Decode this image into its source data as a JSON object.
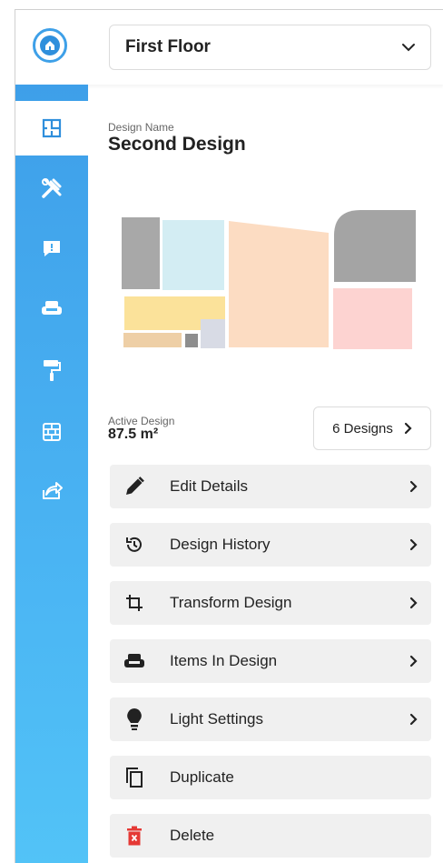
{
  "header": {
    "floor_selector": {
      "value": "First Floor"
    }
  },
  "sidebar": {
    "items": [
      {
        "icon": "floorplan-icon",
        "active": true
      },
      {
        "icon": "tools-icon",
        "active": false
      },
      {
        "icon": "comment-icon",
        "active": false
      },
      {
        "icon": "sofa-icon",
        "active": false
      },
      {
        "icon": "paint-roller-icon",
        "active": false
      },
      {
        "icon": "wall-bricks-icon",
        "active": false
      },
      {
        "icon": "share-icon",
        "active": false
      }
    ]
  },
  "design": {
    "name_label": "Design Name",
    "name": "Second Design",
    "active_label": "Active Design",
    "area": "87.5 m²",
    "designs_button": "6 Designs"
  },
  "menu": [
    {
      "label": "Edit Details",
      "icon": "pencil-icon"
    },
    {
      "label": "Design History",
      "icon": "history-icon"
    },
    {
      "label": "Transform Design",
      "icon": "crop-icon"
    },
    {
      "label": "Items In Design",
      "icon": "sofa-icon"
    },
    {
      "label": "Light Settings",
      "icon": "bulb-icon"
    },
    {
      "label": "Duplicate",
      "icon": "duplicate-icon"
    },
    {
      "label": "Delete",
      "icon": "trash-icon"
    }
  ],
  "colors": {
    "sidebar_top": "#3e9fe9",
    "sidebar_bottom": "#52c3f7",
    "delete_red": "#e53935"
  }
}
